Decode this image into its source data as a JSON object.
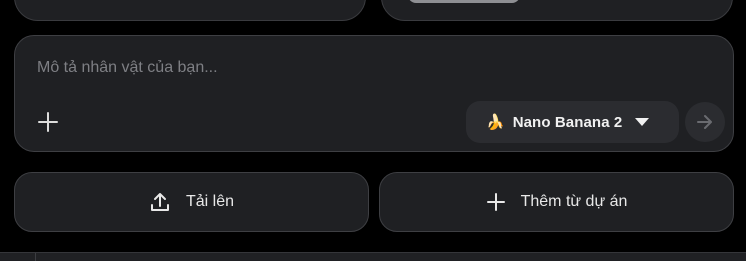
{
  "composer": {
    "placeholder": "Mô tả nhân vật của bạn...",
    "add_icon": "plus-icon",
    "model_selector": {
      "emoji": "🍌",
      "label": "Nano Banana 2",
      "caret_icon": "caret-down-icon"
    },
    "send_icon": "arrow-right-icon"
  },
  "actions": {
    "upload_label": "Tải lên",
    "upload_icon": "upload-icon",
    "add_from_project_label": "Thêm từ dự án",
    "add_from_project_icon": "plus-icon"
  },
  "colors": {
    "background": "#000000",
    "surface": "#1f2023",
    "surface_raised": "#2b2c30",
    "border": "#3e3f43",
    "text": "#e8e8e8",
    "placeholder": "#7e7f84"
  }
}
